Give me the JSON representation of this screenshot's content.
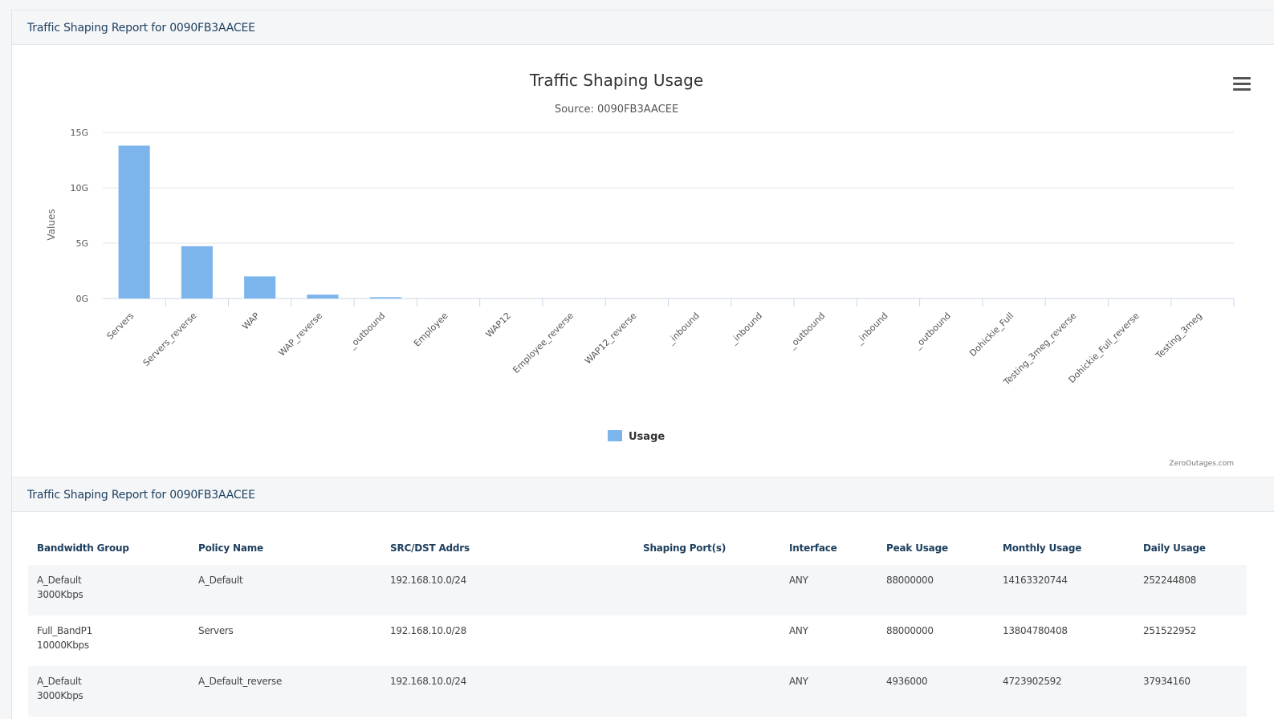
{
  "report_title": "Traffic Shaping Report for 0090FB3AACEE",
  "table_title": "Traffic Shaping Report for 0090FB3AACEE",
  "colors": {
    "bar": "#7cb5ec",
    "grid": "#e6e6e6",
    "header_bg": "#f4f6f8",
    "title": "#1d3f5e"
  },
  "chart_data": {
    "type": "bar",
    "title": "Traffic Shaping Usage",
    "subtitle": "Source: 0090FB3AACEE",
    "ylabel": "Values",
    "xlabel": "",
    "ylim": [
      0,
      15000000000
    ],
    "yticks": [
      "0G",
      "5G",
      "10G",
      "15G"
    ],
    "categories": [
      "Servers",
      "Servers_reverse",
      "WAP",
      "WAP_reverse",
      "_outbound",
      "Employee",
      "WAP12",
      "Employee_reverse",
      "WAP12_reverse",
      "_inbound",
      "_inbound",
      "_outbound",
      "_inbound",
      "_outbound",
      "Dohickie_Full",
      "Testing_3meg_reverse",
      "Dohickie_Full_reverse",
      "Testing_3meg"
    ],
    "series": [
      {
        "name": "Usage",
        "values": [
          13804780408,
          4723902592,
          2000000000,
          350000000,
          120000000,
          20000000,
          10000000,
          5000000,
          3000000,
          2000000,
          1000000,
          1000000,
          500000,
          500000,
          300000,
          200000,
          100000,
          100000
        ]
      }
    ],
    "legend": "bottom-center",
    "grid": true,
    "credits": "ZeroOutages.com"
  },
  "table": {
    "headers": [
      "Bandwidth Group",
      "Policy Name",
      "SRC/DST Addrs",
      "Shaping Port(s)",
      "Interface",
      "Peak Usage",
      "Monthly Usage",
      "Daily Usage"
    ],
    "rows": [
      {
        "group": "A_Default",
        "rate": "3000Kbps",
        "policy": "A_Default",
        "addrs": "192.168.10.0/24",
        "ports": "",
        "iface": "ANY",
        "peak": "88000000",
        "monthly": "14163320744",
        "daily": "252244808"
      },
      {
        "group": "Full_BandP1",
        "rate": "10000Kbps",
        "policy": "Servers",
        "addrs": "192.168.10.0/28",
        "ports": "",
        "iface": "ANY",
        "peak": "88000000",
        "monthly": "13804780408",
        "daily": "251522952"
      },
      {
        "group": "A_Default",
        "rate": "3000Kbps",
        "policy": "A_Default_reverse",
        "addrs": "192.168.10.0/24",
        "ports": "",
        "iface": "ANY",
        "peak": "4936000",
        "monthly": "4723902592",
        "daily": "37934160"
      }
    ]
  },
  "icons": {
    "menu": "hamburger-menu-icon"
  }
}
